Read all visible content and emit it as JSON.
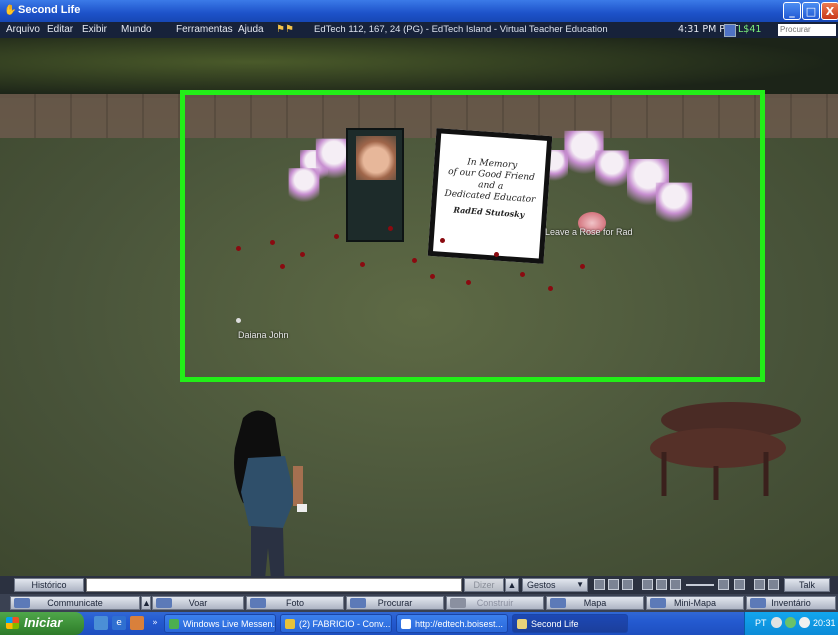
{
  "window": {
    "title": "Second Life",
    "controls": {
      "minimize": "_",
      "maximize": "□",
      "close": "X"
    }
  },
  "menubar": {
    "items": [
      "Arquivo",
      "Editar",
      "Exibir",
      "Mundo",
      "Ferramentas",
      "Ajuda"
    ],
    "location": "EdTech 112, 167, 24 (PG) - EdTech Island - Virtual Teacher Education",
    "clock": "4:31 PM PDT",
    "balance": "L$41",
    "search_placeholder": "Procurar"
  },
  "scene": {
    "memorial_text": [
      "In Memory",
      "of our Good Friend",
      "and a",
      "Dedicated Educator",
      "RadEd Stutosky"
    ],
    "rose_label": "Leave a Rose for Rad",
    "avatar_name": "Daiana John",
    "highlight_color": "#22ee18"
  },
  "chatbar": {
    "history_label": "Histórico",
    "say_label": "Dizer",
    "gestures_label": "Gestos",
    "talk_label": "Talk"
  },
  "toolbar": {
    "items": [
      {
        "label": "Communicate",
        "icon": "chat-bubble-icon",
        "enabled": true
      },
      {
        "label": "Voar",
        "icon": "fly-icon",
        "enabled": true
      },
      {
        "label": "Foto",
        "icon": "camera-icon",
        "enabled": true
      },
      {
        "label": "Procurar",
        "icon": "search-icon",
        "enabled": true
      },
      {
        "label": "Construir",
        "icon": "build-icon",
        "enabled": false
      },
      {
        "label": "Mapa",
        "icon": "map-icon",
        "enabled": true
      },
      {
        "label": "Mini-Mapa",
        "icon": "minimap-icon",
        "enabled": true
      },
      {
        "label": "Inventário",
        "icon": "inventory-icon",
        "enabled": true
      }
    ]
  },
  "taskbar": {
    "start_label": "Iniciar",
    "tasks": [
      {
        "label": "Windows Live Messen...",
        "icon": "messenger-icon"
      },
      {
        "label": "(2) FABRICIO - Conv...",
        "icon": "conversation-icon"
      },
      {
        "label": "http://edtech.boisest...",
        "icon": "browser-icon"
      },
      {
        "label": "Second Life",
        "icon": "second-life-icon",
        "active": true
      }
    ],
    "tray": {
      "lang": "PT",
      "time": "20:31"
    }
  }
}
